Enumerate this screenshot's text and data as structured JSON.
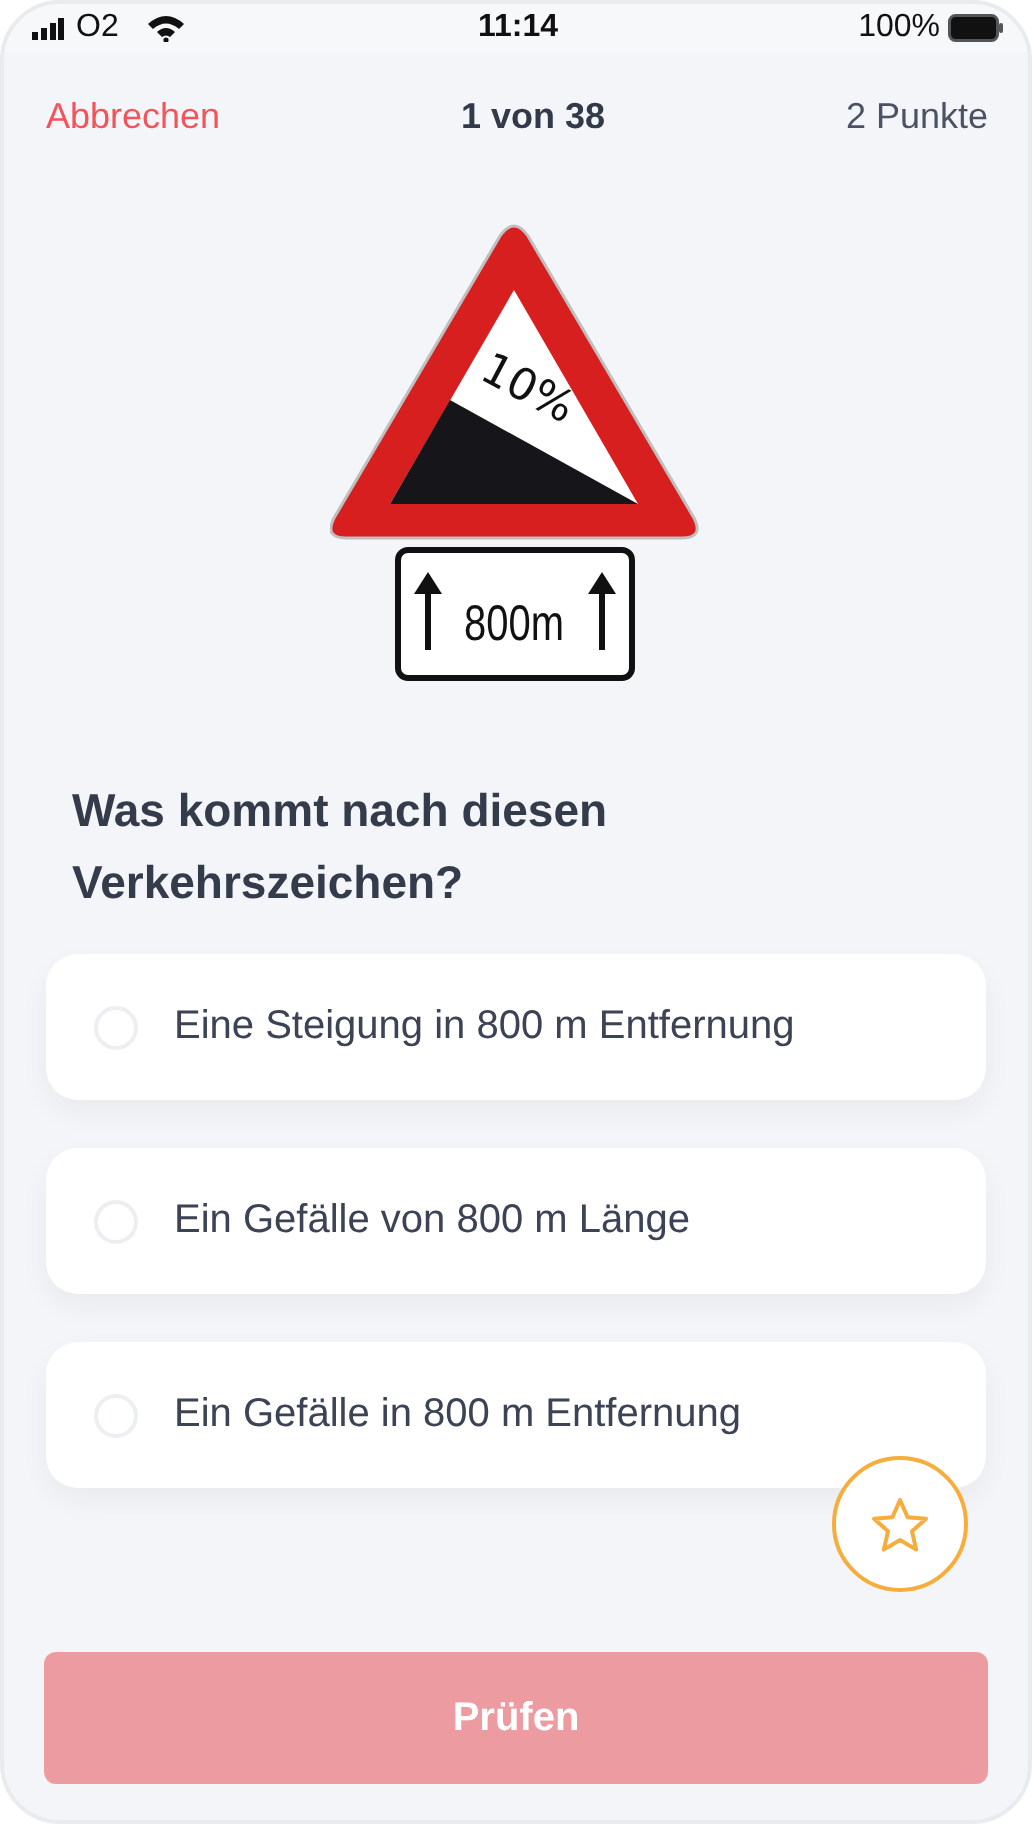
{
  "status_bar": {
    "carrier": "O2",
    "time": "11:14",
    "battery": "100%"
  },
  "header": {
    "cancel": "Abbrechen",
    "progress": "1 von 38",
    "points": "2 Punkte"
  },
  "sign": {
    "grade": "10%",
    "distance": "800m"
  },
  "question": "Was kommt nach diesen Verkehrszeichen?",
  "answers": [
    {
      "text": "Eine Steigung in 800 m Entfernung",
      "selected": false
    },
    {
      "text": "Ein Gefälle von 800 m Länge",
      "selected": false
    },
    {
      "text": "Ein Gefälle in 800 m Entfernung",
      "selected": false
    }
  ],
  "favorite": {
    "on": false
  },
  "check_button": {
    "label": "Prüfen",
    "disabled": true
  }
}
